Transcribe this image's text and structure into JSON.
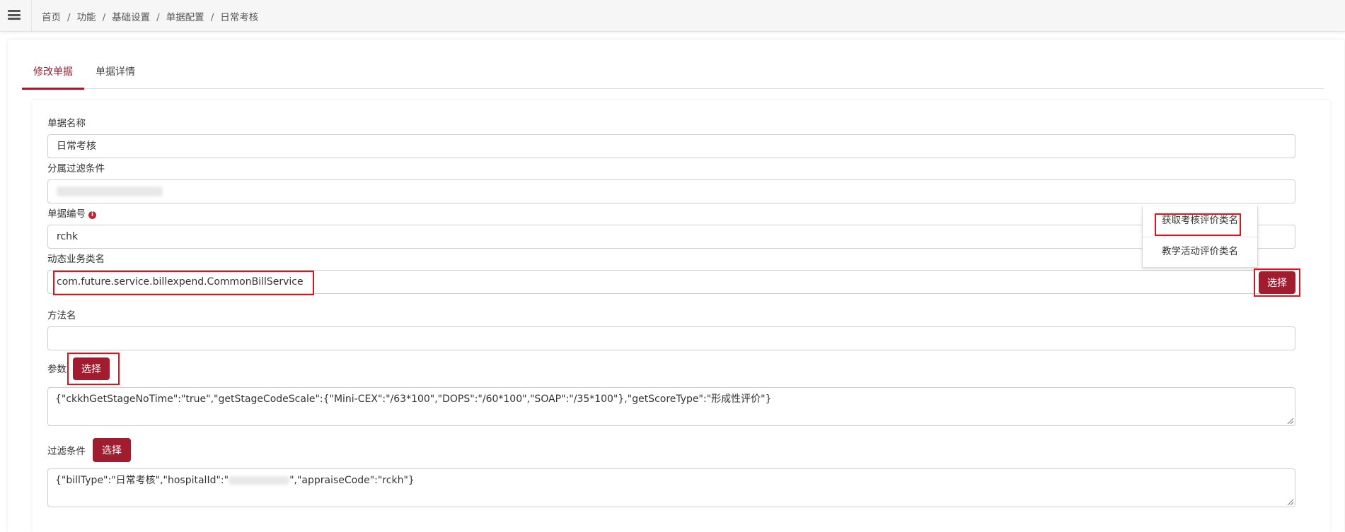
{
  "breadcrumb": [
    {
      "label": "首页"
    },
    {
      "label": "功能"
    },
    {
      "label": "基础设置"
    },
    {
      "label": "单据配置"
    },
    {
      "label": "日常考核"
    }
  ],
  "tabs": [
    {
      "label": "修改单据",
      "active": true
    },
    {
      "label": "单据详情",
      "active": false
    }
  ],
  "form": {
    "bill_name": {
      "label": "单据名称",
      "value": "日常考核"
    },
    "filter_by": {
      "label": "分属过滤条件",
      "value": ""
    },
    "bill_code": {
      "label": "单据编号",
      "value": "rchk"
    },
    "class_name": {
      "label": "动态业务类名",
      "value": "com.future.service.billexpend.CommonBillService"
    },
    "method_name": {
      "label": "方法名",
      "value": ""
    },
    "params": {
      "label": "参数",
      "value": "{\"ckkhGetStageNoTime\":\"true\",\"getStageCodeScale\":{\"Mini-CEX\":\"/63*100\",\"DOPS\":\"/60*100\",\"SOAP\":\"/35*100\"},\"getScoreType\":\"形成性评价\"}"
    },
    "filter": {
      "label": "过滤条件",
      "value_prefix": "{\"billType\":\"日常考核\",\"hospitalId\":\"",
      "value_suffix": "\",\"appraiseCode\":\"rckh\"}"
    }
  },
  "buttons": {
    "select_label": "选择"
  },
  "dropdown": {
    "items": [
      "获取考核评价类名",
      "教学活动评价类名"
    ]
  },
  "colors": {
    "primary": "#a11c2f",
    "highlight": "#e3121a",
    "info_icon": "#c0272d"
  },
  "icons": {
    "menu": "hamburger-menu-icon",
    "info": "info-icon"
  }
}
